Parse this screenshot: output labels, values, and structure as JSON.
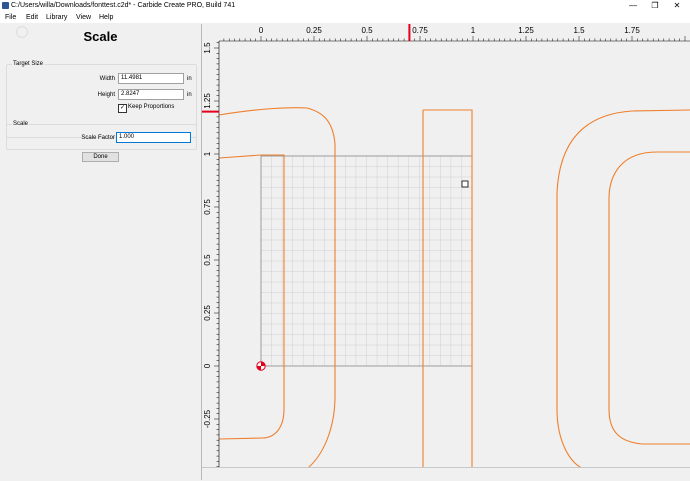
{
  "window": {
    "title": "C:/Users/willa/Downloads/fonttest.c2d* - Carbide Create PRO, Build 741",
    "controls": {
      "minimize": "—",
      "restore": "❐",
      "close": "✕"
    }
  },
  "menu": {
    "file": "File",
    "edit": "Edit",
    "library": "Library",
    "view": "View",
    "help": "Help"
  },
  "panel": {
    "title": "Scale",
    "target_size": {
      "label": "Target Size",
      "width_label": "Width",
      "width_value": "11.4981",
      "height_label": "Height",
      "height_value": "2.8247",
      "unit": "in",
      "keep_proportions_label": "Keep Proportions",
      "keep_proportions_checked": true
    },
    "scale": {
      "label": "Scale",
      "factor_label": "Scale Factor",
      "factor_value": "1.000"
    },
    "done_label": "Done"
  },
  "ruler": {
    "x_ticks": [
      "0",
      "0.25",
      "0.5",
      "0.75",
      "1",
      "1.25",
      "1.5",
      "1.75"
    ],
    "y_ticks": [
      "1.5",
      "1.25",
      "1",
      "0.75",
      "0.5",
      "0.25",
      "0",
      "-0.25"
    ],
    "cursor_x": 0.7,
    "cursor_y": 1.2
  },
  "colors": {
    "vector": "#ee7f2d",
    "cursor": "#e2001a",
    "grid": "#d0d0d0",
    "origin": "#e2001a"
  }
}
